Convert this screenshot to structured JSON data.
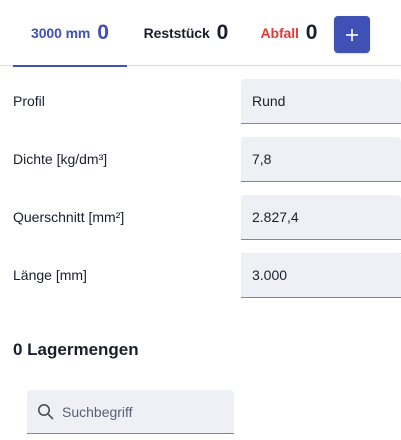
{
  "tabs": [
    {
      "label": "3000 mm",
      "count": "0",
      "active": true
    },
    {
      "label": "Reststück",
      "count": "0",
      "active": false
    },
    {
      "label": "Abfall",
      "count": "0",
      "active": false
    }
  ],
  "add_button": {
    "icon": "plus-icon",
    "glyph": "+"
  },
  "form": {
    "fields": [
      {
        "label": "Profil",
        "value": "Rund"
      },
      {
        "label": "Dichte [kg/dm³]",
        "value": "7,8"
      },
      {
        "label": "Querschnitt [mm²]",
        "value": "2.827,4"
      },
      {
        "label": "Länge [mm]",
        "value": "3.000"
      }
    ]
  },
  "lagermengen": {
    "heading": "0 Lagermengen",
    "search": {
      "placeholder": "Suchbegriff",
      "value": "",
      "icon": "search-icon"
    }
  },
  "colors": {
    "accent": "#3f51b5",
    "abfall": "#e23b3b",
    "field_bg": "#eef0f5"
  }
}
